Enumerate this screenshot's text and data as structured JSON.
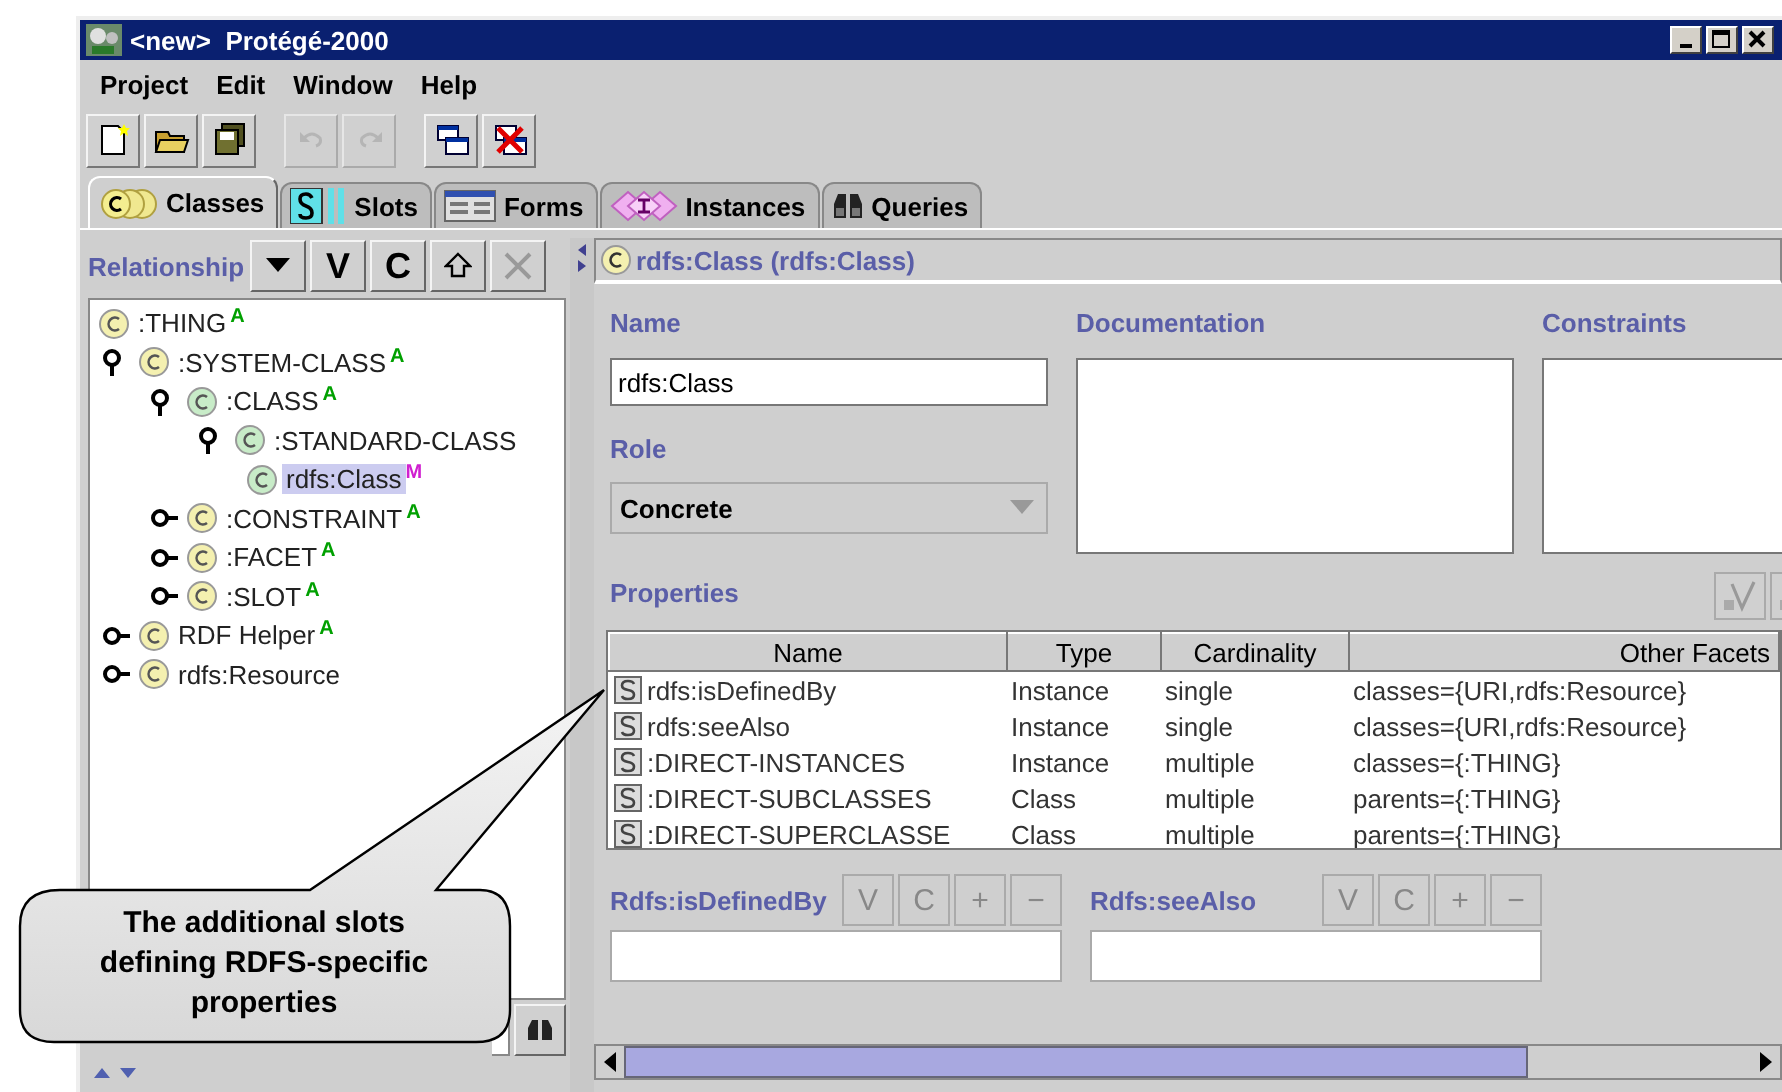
{
  "window": {
    "title": "<new>  Protégé-2000"
  },
  "menu": [
    "Project",
    "Edit",
    "Window",
    "Help"
  ],
  "toolbar": [
    {
      "kind": "new",
      "disabled": false
    },
    {
      "kind": "open",
      "disabled": false
    },
    {
      "kind": "save",
      "disabled": false
    },
    {
      "kind": "undo",
      "disabled": true
    },
    {
      "kind": "redo",
      "disabled": true
    },
    {
      "kind": "cascade",
      "disabled": false
    },
    {
      "kind": "close-all",
      "disabled": false
    }
  ],
  "tabs": [
    {
      "label": "Classes",
      "kind": "classes",
      "selected": true
    },
    {
      "label": "Slots",
      "kind": "slots",
      "selected": false
    },
    {
      "label": "Forms",
      "kind": "forms",
      "selected": false
    },
    {
      "label": "Instances",
      "kind": "instances",
      "selected": false
    },
    {
      "label": "Queries",
      "kind": "queries",
      "selected": false
    }
  ],
  "class_panel": {
    "title": "Relationship",
    "buttons": [
      {
        "kind": "menu",
        "disabled": false
      },
      {
        "kind": "text",
        "label": "V",
        "disabled": false
      },
      {
        "kind": "text",
        "label": "C",
        "disabled": false
      },
      {
        "kind": "up",
        "disabled": false
      },
      {
        "kind": "delete",
        "disabled": true
      }
    ],
    "tree": [
      {
        "label": ":THING",
        "color": "#f4f0b0",
        "badge": {
          "text": "A",
          "color": "#00a000"
        },
        "selected": false,
        "children": [
          {
            "label": ":SYSTEM-CLASS",
            "color": "#f4f0b0",
            "badge": {
              "text": "A",
              "color": "#00a000"
            },
            "selected": false,
            "expanded": true,
            "children": [
              {
                "label": ":CLASS",
                "color": "#c8ecc8",
                "badge": {
                  "text": "A",
                  "color": "#00a000"
                },
                "selected": false,
                "expanded": true,
                "children": [
                  {
                    "label": ":STANDARD-CLASS",
                    "color": "#c8ecc8",
                    "selected": false,
                    "expanded": true,
                    "children": [
                      {
                        "label": "rdfs:Class",
                        "color": "#c8ecc8",
                        "badge": {
                          "text": "M",
                          "color": "#d020d0"
                        },
                        "selected": true
                      }
                    ]
                  }
                ]
              },
              {
                "label": ":CONSTRAINT",
                "color": "#f4f0b0",
                "badge": {
                  "text": "A",
                  "color": "#00a000"
                },
                "selected": false,
                "expanded": false
              },
              {
                "label": ":FACET",
                "color": "#f4f0b0",
                "badge": {
                  "text": "A",
                  "color": "#00a000"
                },
                "selected": false,
                "expanded": false
              },
              {
                "label": ":SLOT",
                "color": "#f4f0b0",
                "badge": {
                  "text": "A",
                  "color": "#00a000"
                },
                "selected": false,
                "expanded": false
              }
            ]
          },
          {
            "label": "RDF Helper",
            "color": "#f4f0b0",
            "badge": {
              "text": "A",
              "color": "#00a000"
            },
            "selected": false,
            "expanded": false
          },
          {
            "label": "rdfs:Resource",
            "color": "#f4f0b0",
            "selected": false,
            "expanded": false
          }
        ]
      }
    ]
  },
  "class_form": {
    "header": "rdfs:Class (rdfs:Class)",
    "name_label": "Name",
    "name_value": "rdfs:Class",
    "documentation_label": "Documentation",
    "constraints_label": "Constraints",
    "role_label": "Role",
    "role_value": "Concrete",
    "properties_label": "Properties",
    "table": {
      "columns": [
        "Name",
        "Type",
        "Cardinality",
        "Other Facets"
      ],
      "rows": [
        [
          "rdfs:isDefinedBy",
          "Instance",
          "single",
          "classes={URI,rdfs:Resource}"
        ],
        [
          "rdfs:seeAlso",
          "Instance",
          "single",
          "classes={URI,rdfs:Resource}"
        ],
        [
          ":DIRECT-INSTANCES",
          "Instance",
          "multiple",
          "classes={:THING}"
        ],
        [
          ":DIRECT-SUBCLASSES",
          "Class",
          "multiple",
          "parents={:THING}"
        ],
        [
          ":DIRECT-SUPERCLASSE",
          "Class",
          "multiple",
          "parents={:THING}"
        ]
      ]
    },
    "slot_widgets": [
      {
        "label": "Rdfs:isDefinedBy",
        "buttons": [
          "V",
          "C",
          "+",
          "−"
        ]
      },
      {
        "label": "Rdfs:seeAlso",
        "buttons": [
          "V",
          "C",
          "+",
          "−"
        ]
      }
    ]
  },
  "callout": "The additional slots defining RDFS-specific properties"
}
